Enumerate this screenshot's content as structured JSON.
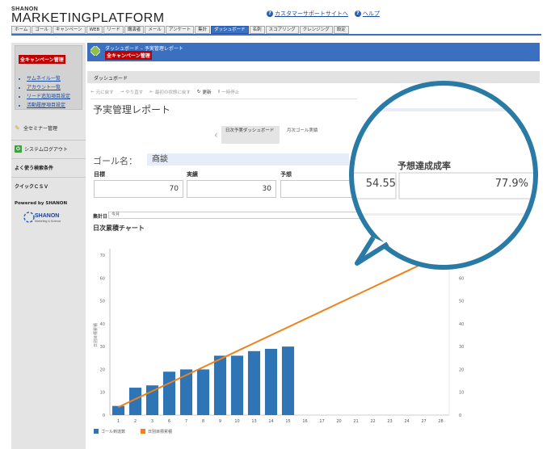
{
  "brand": {
    "small": "SHANON",
    "big": "MARKETINGPLATFORM"
  },
  "header_links": [
    "カスタマーサポートサイトへ",
    "ヘルプ"
  ],
  "nav_tabs": [
    "ホーム",
    "ゴール",
    "キャンペーン",
    "WEB",
    "リード",
    "講演者",
    "メール",
    "アンケート",
    "集計",
    "ダッシュボード",
    "名刺",
    "スコアリング",
    "クレンジング",
    "設定"
  ],
  "nav_active_index": 9,
  "sidebar": {
    "campaign_title": "全キャンペーン管理",
    "links": [
      "サムネイル一覧",
      "アカウント一覧",
      "リード追加項目設定",
      "活動履歴項目設定"
    ],
    "seminar": "全セミナー管理",
    "syslog": "システムログアウト",
    "search": "よく使う検索条件",
    "quick": "クイックＣＳＶ",
    "powered": "Powered by SHANON",
    "logo_text": "SHANON",
    "logo_tagline": "Marketing is Science"
  },
  "band": {
    "title": "ダッシュボード – 予実管理レポート",
    "badge": "全キャンペーン管理"
  },
  "subheader": "ダッシュボード",
  "toolbar": [
    "元に戻す",
    "やり直す",
    "最初の状態に戻す",
    "更新",
    "一時停止"
  ],
  "page_title": "予実管理レポート",
  "report_tabs": [
    "日次予実ダッシュボード",
    "月次ゴール実績"
  ],
  "goal_label": "ゴール名：",
  "goal_value": "商談",
  "metrics": {
    "target_label": "目標",
    "target_value": "70",
    "actual_label": "実績",
    "actual_value": "30",
    "forecast_label": "予想",
    "forecast_value": "54.55",
    "rate_label": "予想達成成率",
    "rate_value": "77.9%"
  },
  "summary_label": "集計日",
  "summary_value": "今月",
  "chart_heading": "日次累積チャート",
  "chart_data": {
    "type": "bar",
    "categories": [
      "1",
      "2",
      "3",
      "6",
      "7",
      "8",
      "9",
      "10",
      "13",
      "14",
      "15",
      "16",
      "17",
      "20",
      "21",
      "22",
      "23",
      "24",
      "27",
      "28"
    ],
    "series": [
      {
        "name": "ゴール到達数",
        "type": "bar",
        "color": "#2f74b5",
        "values": [
          4,
          12,
          13,
          19,
          20,
          20,
          26,
          26,
          28,
          29,
          30,
          null,
          null,
          null,
          null,
          null,
          null,
          null,
          null,
          null
        ]
      },
      {
        "name": "日別目標累積",
        "type": "line",
        "color": "#f0811a",
        "values": [
          3.5,
          7,
          10.5,
          14,
          17.5,
          21,
          24.5,
          28,
          31.5,
          35,
          38.5,
          42,
          45.5,
          49,
          52.5,
          56,
          59.5,
          63,
          66.5,
          70
        ]
      }
    ],
    "ylim": [
      0,
      70
    ],
    "yticks": [
      0,
      10,
      20,
      30,
      40,
      50,
      60,
      70
    ],
    "ylabel": "日別目標累積",
    "ylabel_right": "ゴール到達数",
    "grid": false,
    "legend_position": "bottom-left"
  }
}
